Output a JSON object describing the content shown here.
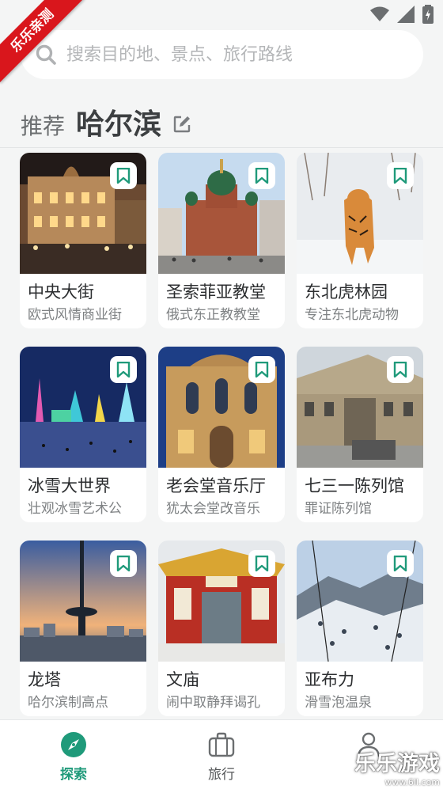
{
  "watermark_ribbon": "乐乐亲测",
  "search": {
    "placeholder": "搜索目的地、景点、旅行路线"
  },
  "header": {
    "label": "推荐",
    "city": "哈尔滨"
  },
  "cards": [
    {
      "title": "中央大街",
      "subtitle": "欧式风情商业街"
    },
    {
      "title": "圣索菲亚教堂",
      "subtitle": "俄式东正教教堂"
    },
    {
      "title": "东北虎林园",
      "subtitle": "专注东北虎动物"
    },
    {
      "title": "冰雪大世界",
      "subtitle": "壮观冰雪艺术公"
    },
    {
      "title": "老会堂音乐厅",
      "subtitle": "犹太会堂改音乐"
    },
    {
      "title": "七三一陈列馆",
      "subtitle": "罪证陈列馆"
    },
    {
      "title": "龙塔",
      "subtitle": "哈尔滨制高点"
    },
    {
      "title": "文庙",
      "subtitle": "闹中取静拜谒孔"
    },
    {
      "title": "亚布力",
      "subtitle": "滑雪泡温泉"
    }
  ],
  "nav": {
    "explore": "探索",
    "trip": "旅行"
  },
  "watermark_logo": {
    "text": "乐乐游戏",
    "domain": "www.6ll.com"
  },
  "colors": {
    "accent": "#1f9a7a",
    "ribbon": "#d9161c",
    "background": "#f4f5f5"
  },
  "icons": [
    "search-icon",
    "edit-icon",
    "bookmark-icon",
    "compass-icon",
    "suitcase-icon",
    "person-icon",
    "wifi-icon",
    "signal-icon",
    "battery-icon"
  ]
}
